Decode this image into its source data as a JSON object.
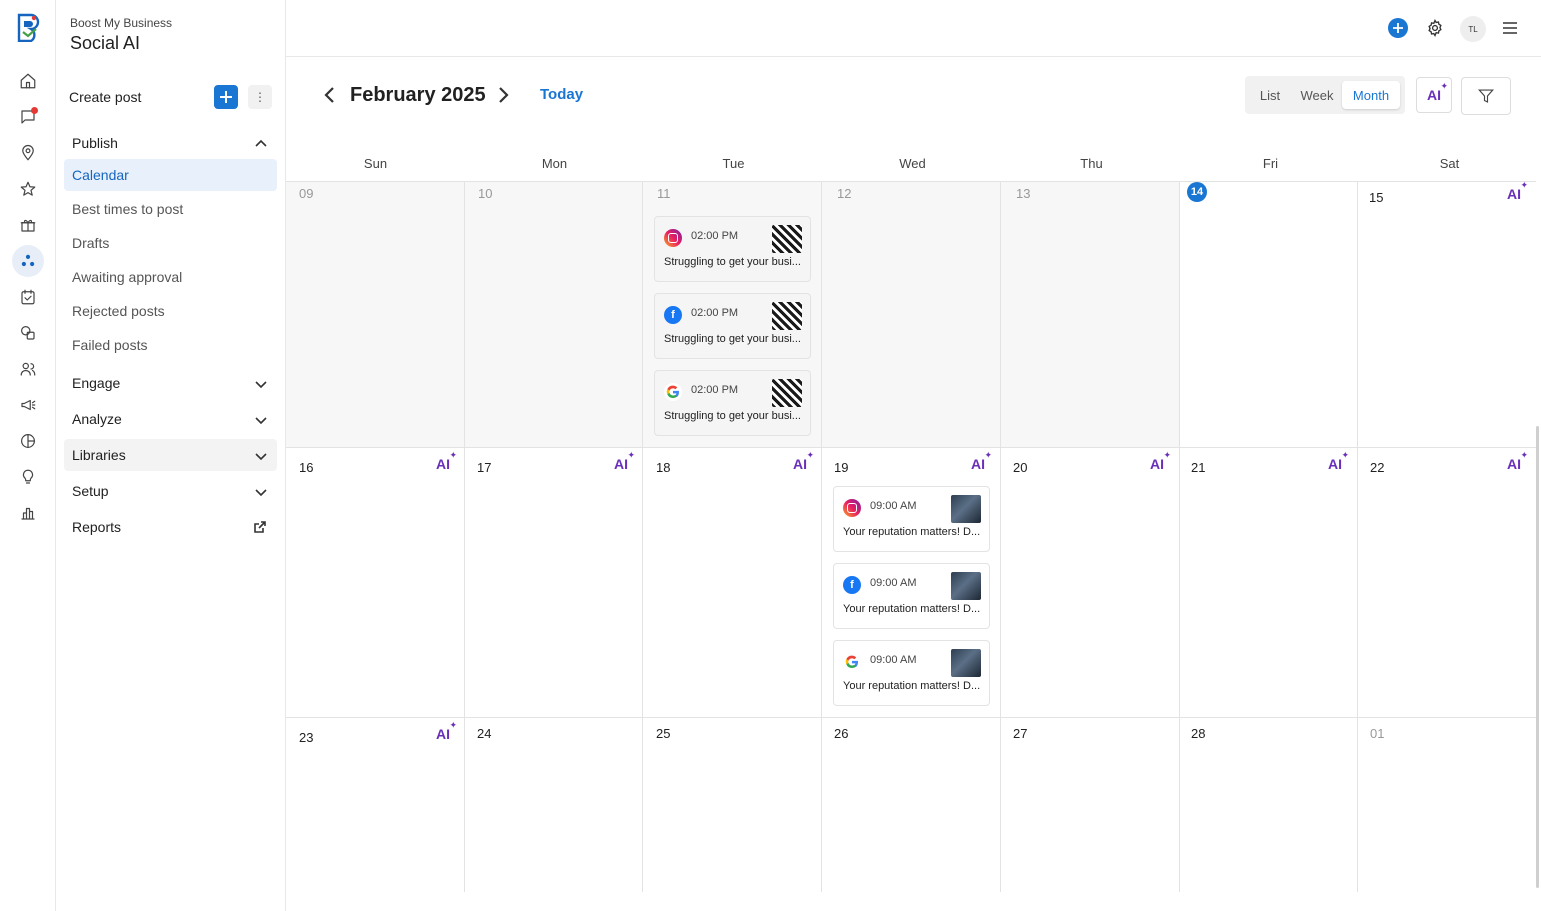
{
  "app": {
    "brand_sub": "Boost My Business",
    "brand_title": "Social AI"
  },
  "nav": {
    "create_post": "Create post",
    "publish": "Publish",
    "publish_items": [
      "Calendar",
      "Best times to post",
      "Drafts",
      "Awaiting approval",
      "Rejected posts",
      "Failed posts"
    ],
    "engage": "Engage",
    "analyze": "Analyze",
    "libraries": "Libraries",
    "setup": "Setup",
    "reports": "Reports"
  },
  "topbar": {
    "avatar_initials": "TL"
  },
  "calendar": {
    "month_title": "February 2025",
    "today_label": "Today",
    "views": [
      "List",
      "Week",
      "Month"
    ],
    "active_view": "Month",
    "ai_label": "AI",
    "days_of_week": [
      "Sun",
      "Mon",
      "Tue",
      "Wed",
      "Thu",
      "Fri",
      "Sat"
    ],
    "weeks": [
      [
        "09",
        "10",
        "11",
        "12",
        "13",
        "14",
        "15"
      ],
      [
        "16",
        "17",
        "18",
        "19",
        "20",
        "21",
        "22"
      ],
      [
        "23",
        "24",
        "25",
        "26",
        "27",
        "28",
        "01"
      ]
    ],
    "today_day": "14",
    "posts_tue_11": [
      {
        "network": "instagram",
        "time": "02:00 PM",
        "text": "Struggling to get your busi..."
      },
      {
        "network": "facebook",
        "time": "02:00 PM",
        "text": "Struggling to get your busi..."
      },
      {
        "network": "google",
        "time": "02:00 PM",
        "text": "Struggling to get your busi..."
      }
    ],
    "posts_wed_19": [
      {
        "network": "instagram",
        "time": "09:00 AM",
        "text": "Your reputation matters! D..."
      },
      {
        "network": "facebook",
        "time": "09:00 AM",
        "text": "Your reputation matters! D..."
      },
      {
        "network": "google",
        "time": "09:00 AM",
        "text": "Your reputation matters! D..."
      }
    ]
  },
  "colors": {
    "accent": "#1976d2",
    "ai_purple": "#6a2fb8"
  }
}
